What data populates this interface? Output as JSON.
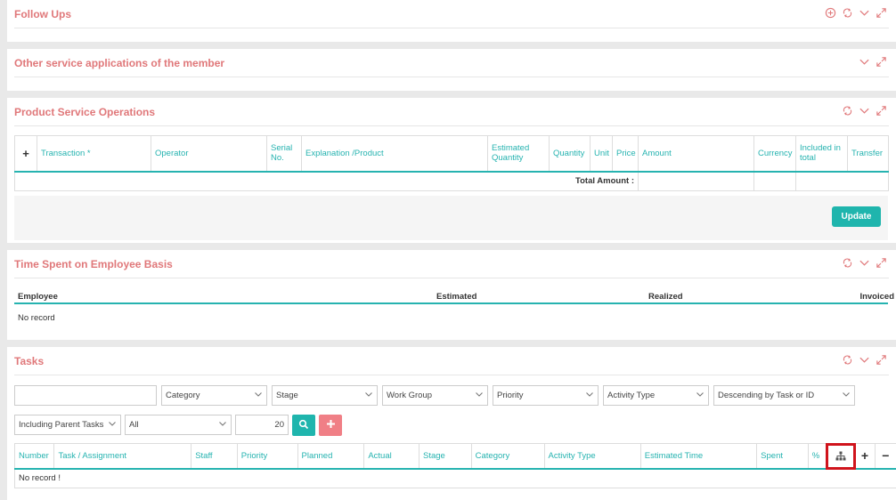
{
  "follow_ups": {
    "title": "Follow Ups"
  },
  "other_services": {
    "title": "Other service applications of the member"
  },
  "pso": {
    "title": "Product Service Operations",
    "add_symbol": "+",
    "columns": [
      "Transaction *",
      "Operator",
      "Serial No.",
      "Explanation /Product",
      "Estimated Quantity",
      "Quantity",
      "Unit",
      "Price",
      "Amount",
      "Currency",
      "Included in total",
      "Transfer"
    ],
    "total_label": "Total Amount :",
    "update_label": "Update"
  },
  "time_spent": {
    "title": "Time Spent on Employee Basis",
    "columns": [
      "Employee",
      "Estimated",
      "Realized",
      "Invoiced"
    ],
    "empty_text": "No record"
  },
  "tasks": {
    "title": "Tasks",
    "search_value": "",
    "filters": {
      "category": "Category",
      "stage": "Stage",
      "work_group": "Work Group",
      "priority": "Priority",
      "activity_type": "Activity Type",
      "sort": "Descending by Task or ID",
      "parent_tasks": "Including Parent Tasks",
      "scope": "All",
      "page_size": "20"
    },
    "columns": [
      "Number",
      "Task / Assignment",
      "Staff",
      "Priority",
      "Planned",
      "Actual",
      "Stage",
      "Category",
      "Activity Type",
      "Estimated Time",
      "Spent",
      "%"
    ],
    "plus_symbol": "+",
    "minus_symbol": "−",
    "empty_text": "No record !"
  },
  "colors": {
    "accent": "#26b3b0",
    "title": "#e0787a",
    "highlight": "#d0141c",
    "add_button": "#f07f86"
  }
}
